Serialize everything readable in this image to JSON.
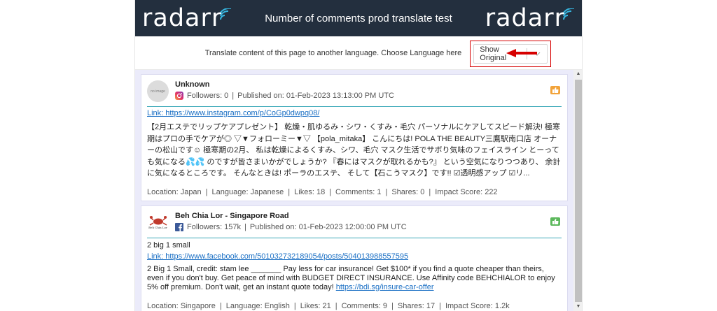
{
  "header": {
    "logo_left": "radar",
    "logo_left_last": "r",
    "title": "Number of comments prod translate test",
    "logo_right": "radar",
    "logo_right_last": "r"
  },
  "translate": {
    "prompt": "Translate content of this page to another language. Choose Language here",
    "selected": "Show Original"
  },
  "colors": {
    "header_bg": "#232f3e",
    "accent_teal": "#3aa8b8",
    "link": "#1a6fc4",
    "highlight_red": "#d60000",
    "sentiment_neutral": "#f2a33a",
    "sentiment_positive": "#5cb85c"
  },
  "posts": [
    {
      "avatar_text": "no image",
      "author": "Unknown",
      "network_icon": "instagram-icon",
      "followers": "Followers: 0",
      "published": "Published on: 01-Feb-2023 13:13:00 PM UTC",
      "sentiment_icon": "thumbs-neutral-icon",
      "link": "Link: https://www.instagram.com/p/CoGp0dwpq08/",
      "text": "【2月エステでリップケアプレゼント】 乾燥・肌ゆるみ・シワ・くすみ・毛穴 パーソナルにケアしてスピード解決! 極寒期はプロの手でケアが◎ ▽▼フォローミー▼▽ 【pola_mitaka】 こんにちは! POLA THE BEAUTY三鷹駅南口店 オーナーの松山です☺ 極寒期の2月、 私は乾燥によるくすみ、シワ、毛穴 マスク生活でサボり気味のフェイスライン とーっても気になる💦💦 のですが皆さまいかがでしょうか? 『春にはマスクが取れるかも?』 という空気になりつつあり、 余計に気になるところです。 そんなときは! ポーラのエステ、 そして【石こうマスク】です!! ☑透明感アップ ☑リ...",
      "location": "Location: Japan",
      "language": "Language: Japanese",
      "likes": "Likes: 18",
      "comments": "Comments: 1",
      "shares": "Shares: 0",
      "impact": "Impact Score: 222"
    },
    {
      "avatar_text": "Beh Chia Lor",
      "author": "Beh Chia Lor - Singapore Road",
      "network_icon": "facebook-icon",
      "followers": "Followers: 157k",
      "published": "Published on: 01-Feb-2023 12:00:00 PM UTC",
      "sentiment_icon": "thumbs-up-icon",
      "title_text": "2 big 1 small",
      "link": "Link: https://www.facebook.com/501032732189054/posts/504013988557595",
      "text": "2 Big 1 Small, credit: stam lee _______ Pay less for car insurance! Get $100* if you find a quote cheaper than theirs, even if you don't buy. Get peace of mind with BUDGET DIRECT INSURANCE. Use Affinity code BEHCHIALOR to enjoy 5% off premium. Don't wait, get an instant quote today!",
      "text_link": "https://bdi.sg/insure-car-offer",
      "location": "Location: Singapore",
      "language": "Language: English",
      "likes": "Likes: 21",
      "comments": "Comments: 9",
      "shares": "Shares: 17",
      "impact": "Impact Score: 1.2k"
    }
  ]
}
